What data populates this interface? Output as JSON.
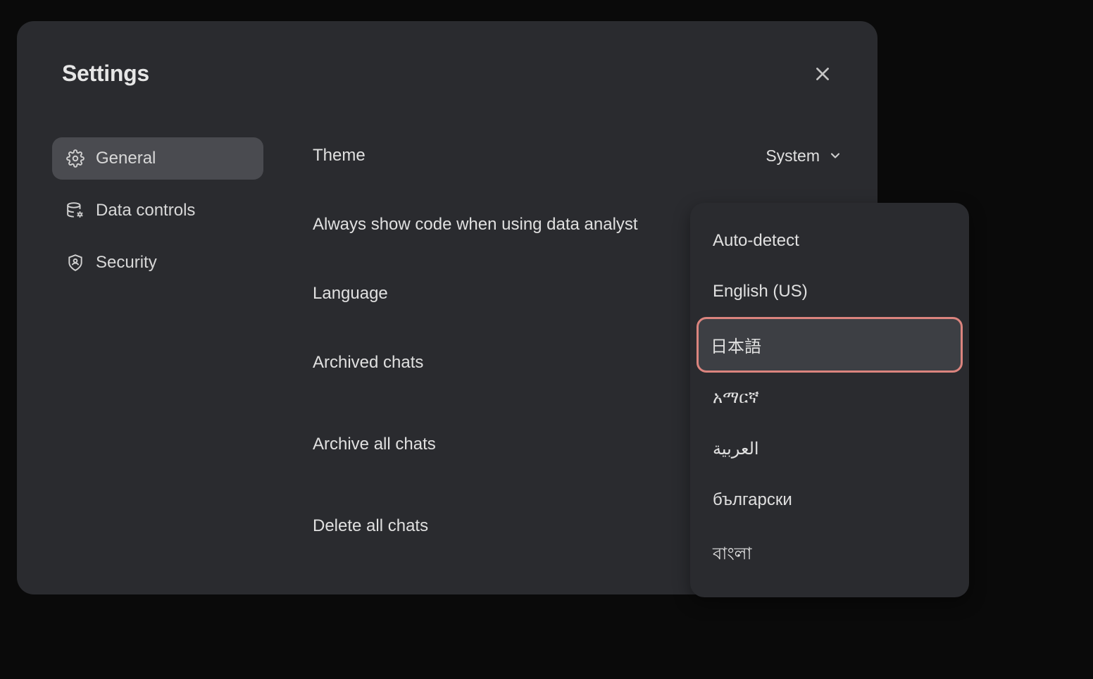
{
  "modal": {
    "title": "Settings"
  },
  "sidebar": {
    "items": [
      {
        "label": "General",
        "active": true
      },
      {
        "label": "Data controls",
        "active": false
      },
      {
        "label": "Security",
        "active": false
      }
    ]
  },
  "settings": {
    "theme": {
      "label": "Theme",
      "value": "System"
    },
    "codeAnalyst": {
      "label": "Always show code when using data analyst"
    },
    "language": {
      "label": "Language"
    },
    "archivedChats": {
      "label": "Archived chats"
    },
    "archiveAll": {
      "label": "Archive all chats"
    },
    "deleteAll": {
      "label": "Delete all chats"
    }
  },
  "languageDropdown": {
    "options": [
      {
        "label": "Auto-detect",
        "highlighted": false
      },
      {
        "label": "English (US)",
        "highlighted": false
      },
      {
        "label": "日本語",
        "highlighted": true
      },
      {
        "label": "አማርኛ",
        "highlighted": false
      },
      {
        "label": "العربية",
        "highlighted": false
      },
      {
        "label": "български",
        "highlighted": false
      },
      {
        "label": "বাংলা",
        "highlighted": false
      }
    ]
  }
}
